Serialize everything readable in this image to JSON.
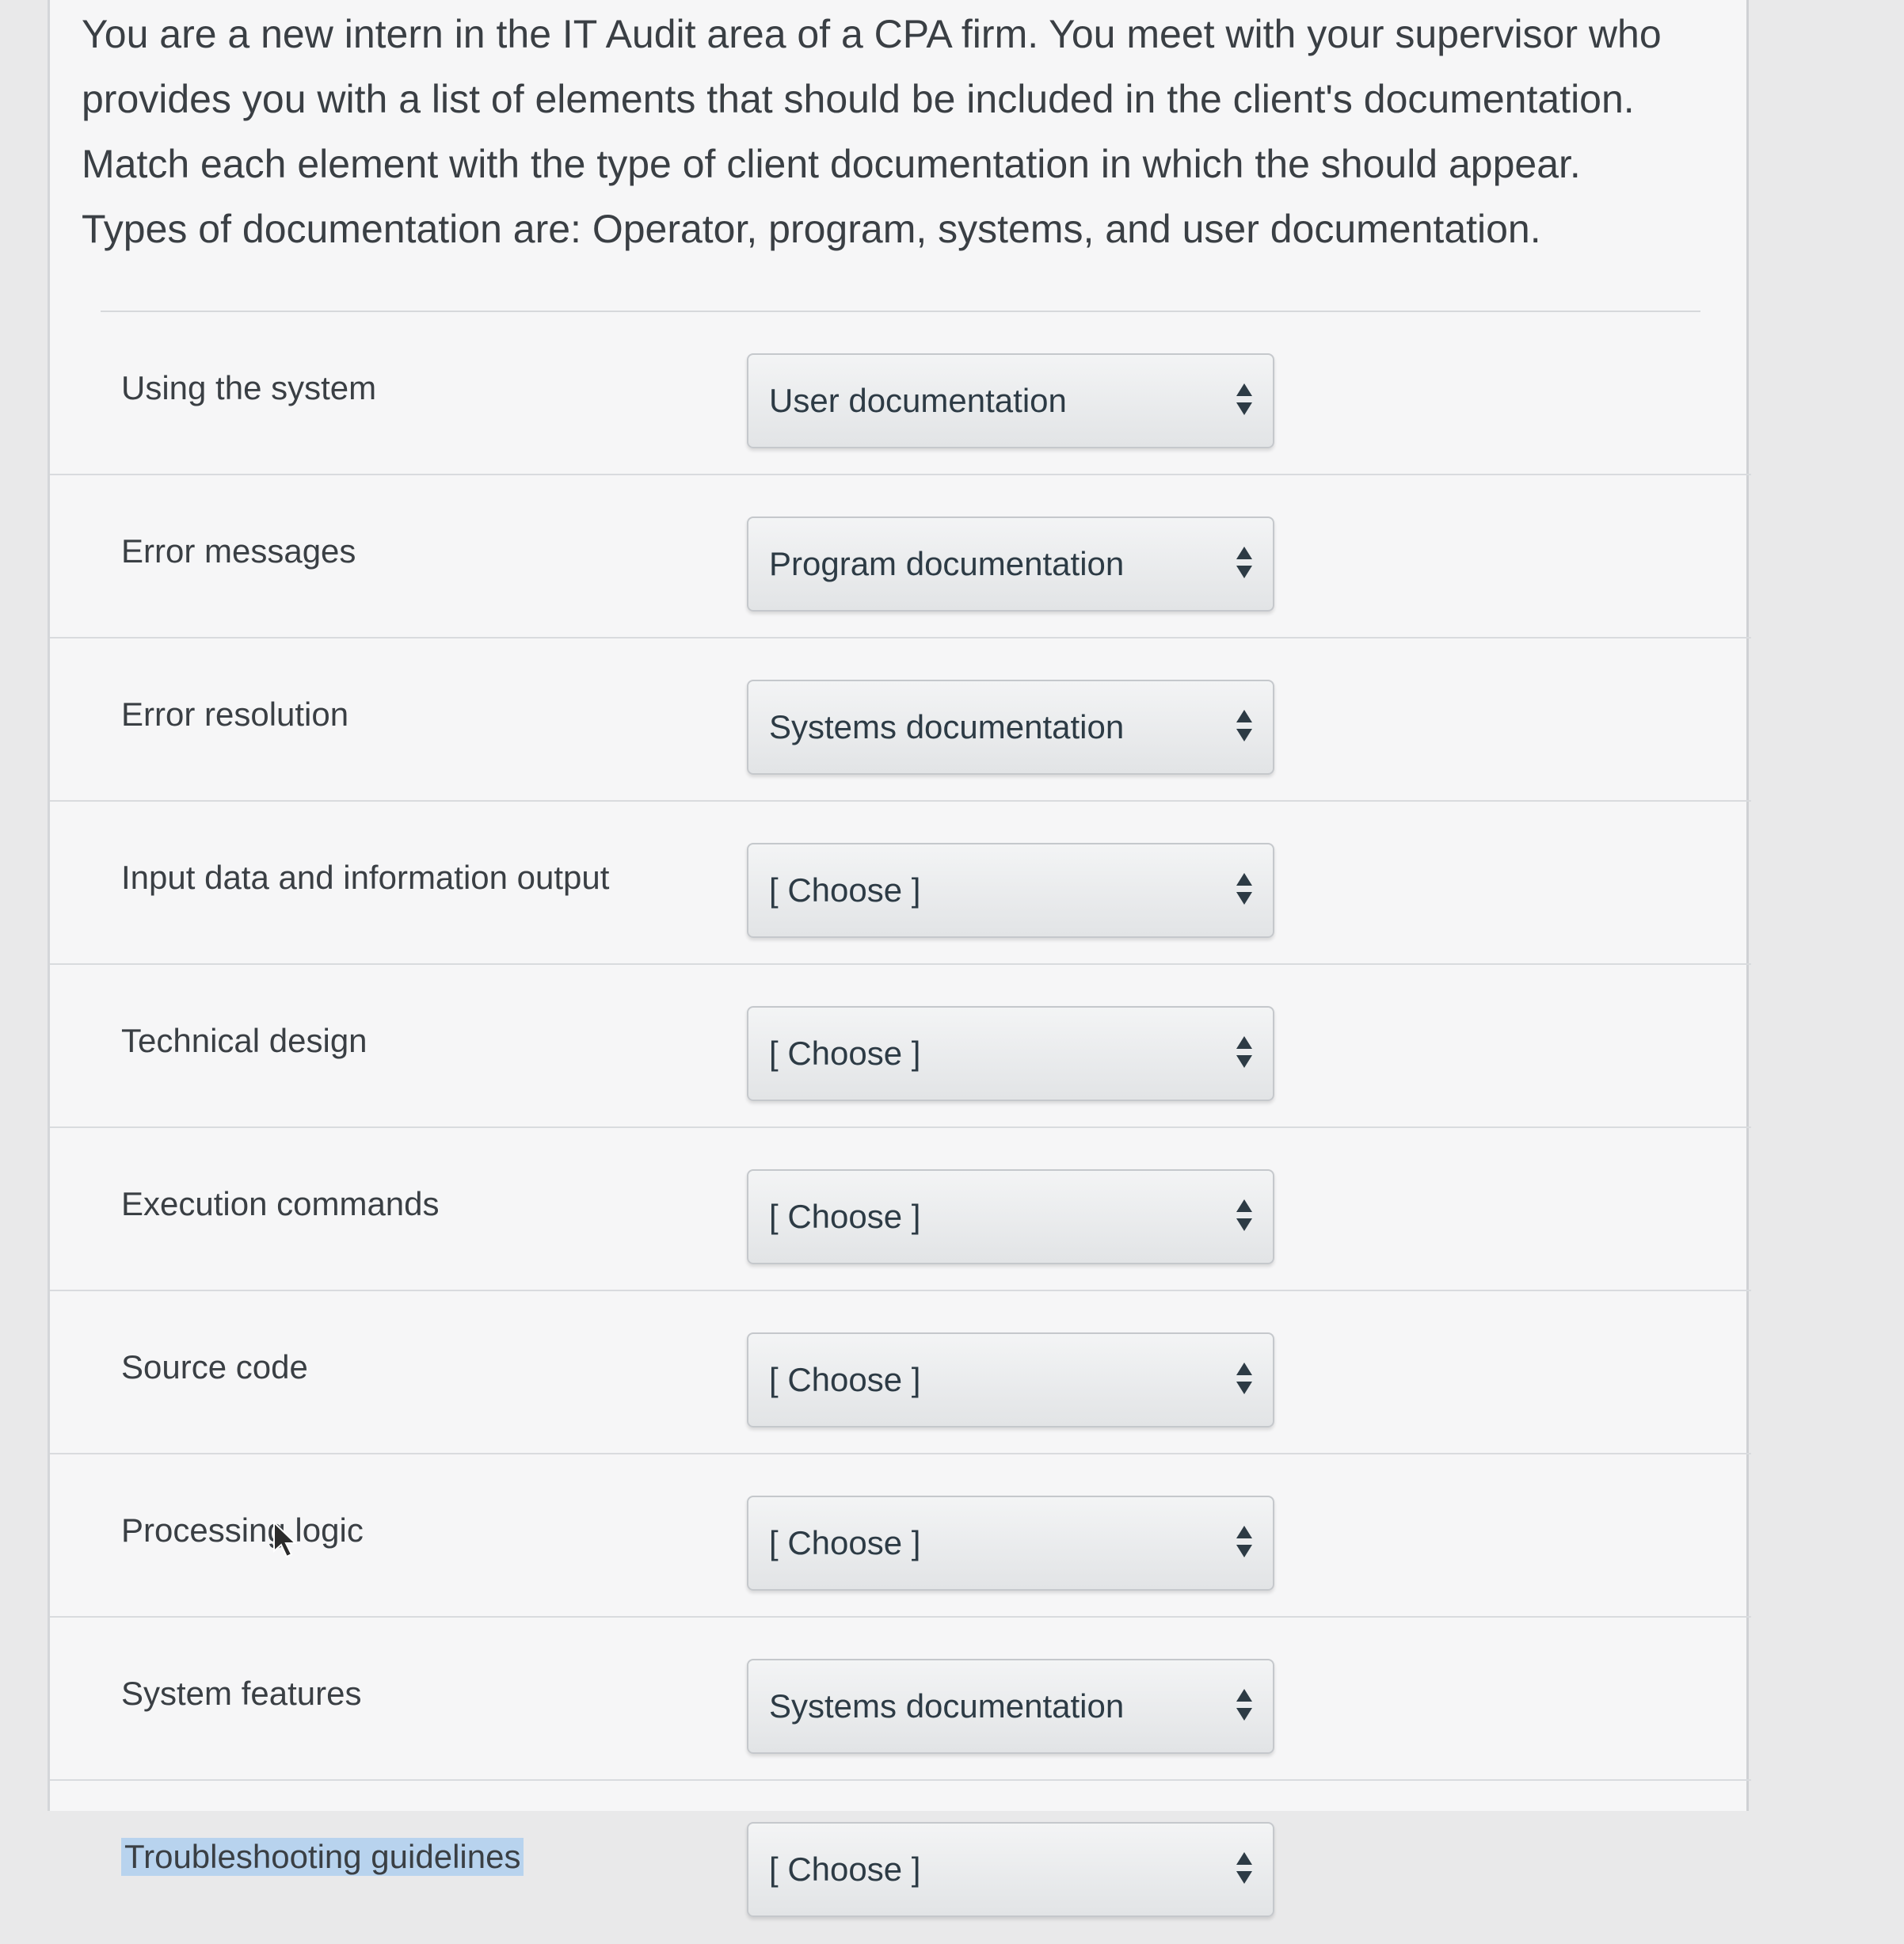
{
  "question": {
    "lines": [
      "You are a new intern in the IT Audit area of a CPA firm. You meet with your supervisor who",
      "provides you with a list of elements that should be included in the client's documentation.",
      "Match each element with the type of client documentation in which the should appear.",
      "Types of documentation are: Operator, program, systems, and user documentation."
    ]
  },
  "matches": [
    {
      "label": "Using the system",
      "value": "User documentation"
    },
    {
      "label": "Error messages",
      "value": "Program documentation"
    },
    {
      "label": "Error resolution",
      "value": "Systems documentation"
    },
    {
      "label": "Input data and information output",
      "value": "[ Choose ]"
    },
    {
      "label": "Technical design",
      "value": "[ Choose ]"
    },
    {
      "label": "Execution commands",
      "value": "[ Choose ]"
    },
    {
      "label": "Source code",
      "value": "[ Choose ]"
    },
    {
      "label": "Processing logic",
      "value": "[ Choose ]"
    },
    {
      "label": "System features",
      "value": "Systems documentation"
    },
    {
      "label": "Troubleshooting guidelines",
      "value": "[ Choose ]"
    }
  ],
  "icons": {
    "select_arrow": "up-down-arrows-icon",
    "mouse_cursor": "mouse-pointer-icon"
  }
}
